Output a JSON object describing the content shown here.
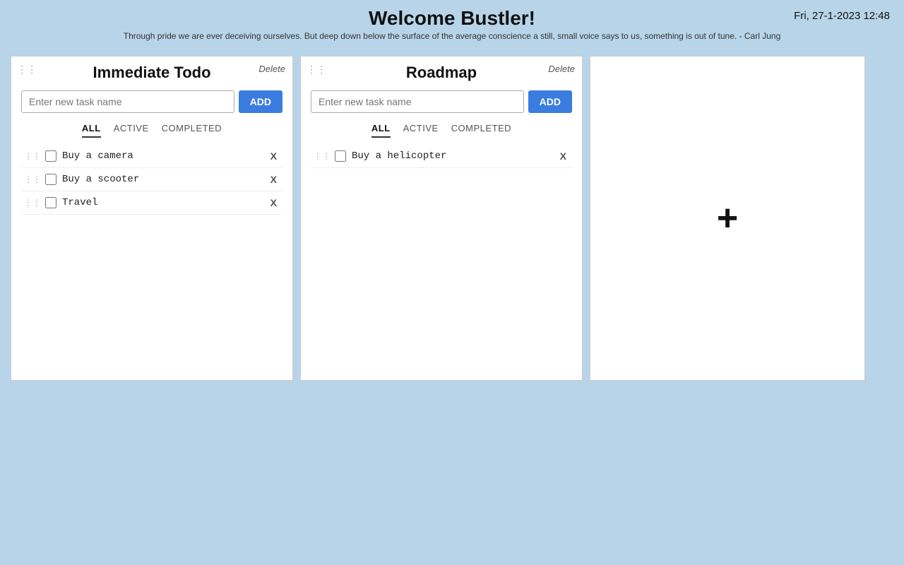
{
  "header": {
    "title": "Welcome Bustler!",
    "quote": "Through pride we are ever deceiving ourselves. But deep down below the surface of the average conscience a still, small voice says to us, something is out of tune. - Carl Jung",
    "datetime": "Fri, 27-1-2023 12:48"
  },
  "cards": [
    {
      "id": "card-1",
      "title": "Immediate Todo",
      "delete_label": "Delete",
      "input_placeholder": "Enter new task name",
      "add_label": "ADD",
      "tabs": [
        {
          "label": "ALL",
          "active": true
        },
        {
          "label": "ACTIVE",
          "active": false
        },
        {
          "label": "COMPLETED",
          "active": false
        }
      ],
      "tasks": [
        {
          "id": "t1",
          "label": "Buy a camera",
          "checked": false
        },
        {
          "id": "t2",
          "label": "Buy a scooter",
          "checked": false
        },
        {
          "id": "t3",
          "label": "Travel",
          "checked": false
        }
      ]
    },
    {
      "id": "card-2",
      "title": "Roadmap",
      "delete_label": "Delete",
      "input_placeholder": "Enter new task name",
      "add_label": "ADD",
      "tabs": [
        {
          "label": "ALL",
          "active": true
        },
        {
          "label": "ACTIVE",
          "active": false
        },
        {
          "label": "COMPLETED",
          "active": false
        }
      ],
      "tasks": [
        {
          "id": "t4",
          "label": "Buy a helicopter",
          "checked": false
        }
      ]
    }
  ],
  "add_card": {
    "icon": "+"
  }
}
